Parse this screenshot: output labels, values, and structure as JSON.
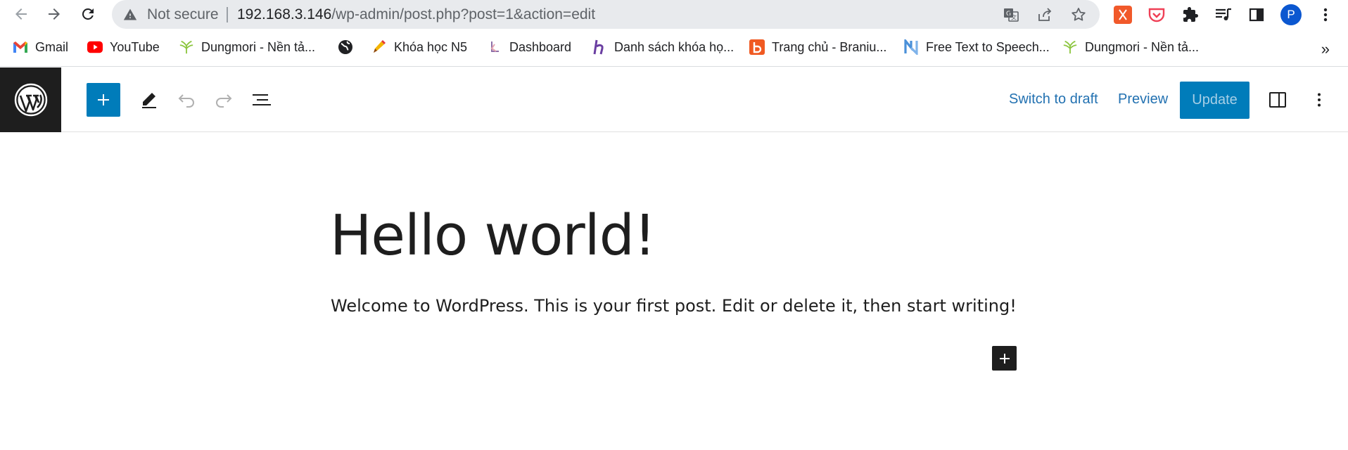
{
  "browser": {
    "security_label": "Not secure",
    "url_host": "192.168.3.146",
    "url_path": "/wp-admin/post.php?post=1&action=edit",
    "profile_initial": "P",
    "profile_color": "#1a73e8",
    "icons": [
      "back-icon",
      "forward-icon",
      "reload-icon",
      "warning-icon",
      "translate-icon",
      "share-icon",
      "star-icon",
      "extension-orange-icon",
      "pocket-icon",
      "puzzle-icon",
      "media-queue-icon",
      "side-panel-icon",
      "menu-dots-icon"
    ]
  },
  "bookmarks": {
    "items": [
      {
        "label": "Gmail",
        "icon": "gmail-icon"
      },
      {
        "label": "YouTube",
        "icon": "youtube-icon"
      },
      {
        "label": "Dungmori - Nền tả...",
        "icon": "dungmori-icon"
      },
      {
        "label": "",
        "icon": "globe-icon"
      },
      {
        "label": "Khóa học N5",
        "icon": "pencil-bookmark-icon"
      },
      {
        "label": "Dashboard",
        "icon": "dashboard-bookmark-icon"
      },
      {
        "label": "Danh sách khóa họ...",
        "icon": "hacker-icon"
      },
      {
        "label": "Trang chủ - Braniu...",
        "icon": "branium-icon"
      },
      {
        "label": "Free Text to Speech...",
        "icon": "tts-icon"
      },
      {
        "label": "Dungmori - Nền tả...",
        "icon": "dungmori-icon"
      }
    ],
    "more_label": "»"
  },
  "editor": {
    "switch_to_draft": "Switch to draft",
    "preview": "Preview",
    "update": "Update",
    "accent": "#007cba"
  },
  "post": {
    "title": "Hello world!",
    "body": "Welcome to WordPress. This is your first post. Edit or delete it, then start writing!"
  }
}
